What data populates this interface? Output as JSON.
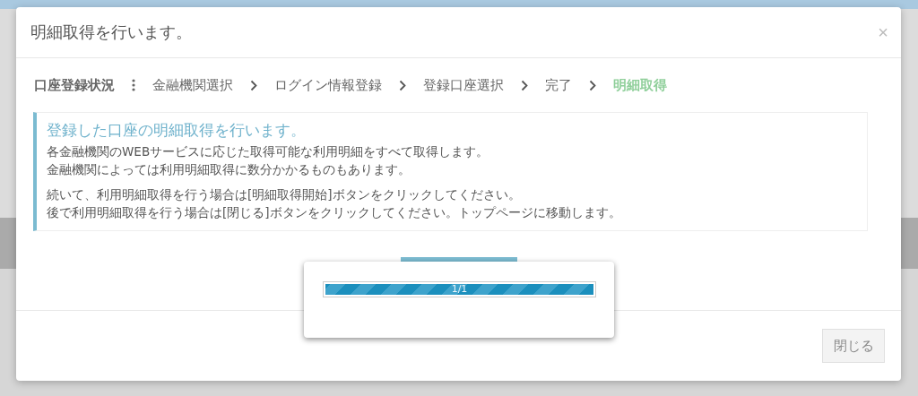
{
  "dialog": {
    "title": "明細取得を行います。",
    "close_icon": "×"
  },
  "status": {
    "label": "口座登録状況",
    "steps": [
      {
        "label": "金融機関選択",
        "selected": false
      },
      {
        "label": "ログイン情報登録",
        "selected": false
      },
      {
        "label": "登録口座選択",
        "selected": false
      },
      {
        "label": "完了",
        "selected": false
      },
      {
        "label": "明細取得",
        "selected": true
      }
    ]
  },
  "info": {
    "heading": "登録した口座の明細取得を行います。",
    "paragraphs": [
      [
        "各金融機関のWEBサービスに応じた取得可能な利用明細をすべて取得します。",
        "金融機関によっては利用明細取得に数分かかるものもあります。"
      ],
      [
        "続いて、利用明細取得を行う場合は[明細取得開始]ボタンをクリックしてください。",
        "後で利用明細取得を行う場合は[閉じる]ボタンをクリックしてください。トップページに移動します。"
      ]
    ]
  },
  "progress": {
    "label": "1/1",
    "level": 1
  },
  "footer": {
    "buttons": [
      "閉じる"
    ]
  }
}
